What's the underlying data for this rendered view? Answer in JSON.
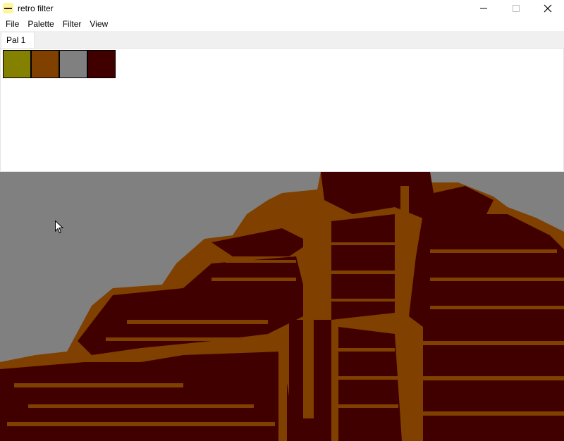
{
  "window": {
    "title": "retro filter",
    "controls": [
      "minimize-icon",
      "maximize-icon",
      "close-icon"
    ]
  },
  "menu": {
    "items": [
      "File",
      "Palette",
      "Filter",
      "View"
    ]
  },
  "tabs": [
    {
      "label": "Pal 1",
      "active": true
    }
  ],
  "palette": {
    "colors": [
      "#848000",
      "#804000",
      "#808080",
      "#400000"
    ]
  },
  "canvas": {
    "description_colors": {
      "sky": "#808080",
      "stone_light": "#804000",
      "stone_dark": "#400000"
    }
  }
}
